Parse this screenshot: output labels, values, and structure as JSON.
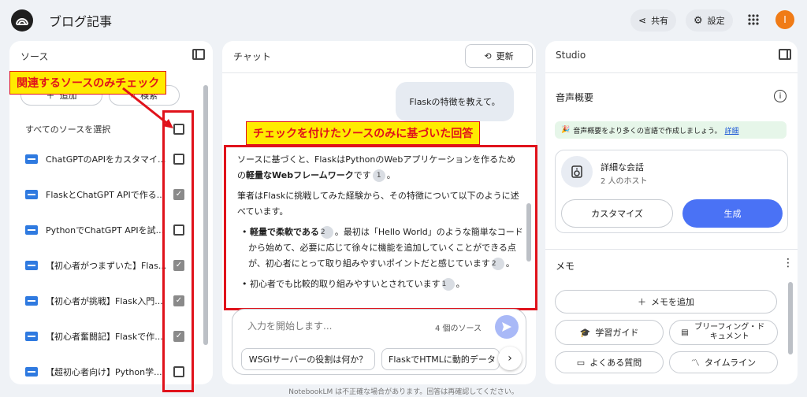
{
  "header": {
    "title": "ブログ記事",
    "share_label": "共有",
    "settings_label": "設定",
    "avatar_letter": "I"
  },
  "sources": {
    "title": "ソース",
    "add_label": "追加",
    "search_label": "検索",
    "select_all_label": "すべてのソースを選択",
    "items": [
      {
        "label": "ChatGPTのAPIをカスタマイ...",
        "checked": false
      },
      {
        "label": "FlaskとChatGPT APIで作る...",
        "checked": true
      },
      {
        "label": "PythonでChatGPT APIを試...",
        "checked": false
      },
      {
        "label": "【初心者がつまずいた】Flas...",
        "checked": true
      },
      {
        "label": "【初心者が挑戦】Flask入門...",
        "checked": true
      },
      {
        "label": "【初心者奮闘記】Flaskで作...",
        "checked": true
      },
      {
        "label": "【超初心者向け】Python学...",
        "checked": false
      }
    ]
  },
  "chat": {
    "title": "チャット",
    "refresh_label": "更新",
    "user_message": "Flaskの特徴を教えて。",
    "response": {
      "p1": "ソースに基づくと、FlaskはPythonのWebアプリケーションを作るための",
      "p1_bold": "軽量なWebフレームワーク",
      "p1_end": "です",
      "p1_cite": "1",
      "p2": "筆者はFlaskに挑戦してみた経験から、その特徴について以下のように述べています。",
      "b1_bold": "軽量で柔軟である",
      "b1_cite": "2",
      "b1_text": "。最初は「Hello World」のような簡単なコードから始めて、必要に応じて徐々に機能を追加していくことができる点が、初心者にとって取り組みやすいポイントだと感じています",
      "b1_cite2": "2",
      "b2_text": "初心者でも比較的取り組みやすいとされています",
      "b2_cite": "1"
    },
    "input_placeholder": "入力を開始します...",
    "source_count": "4 個のソース",
    "suggestions": [
      "WSGIサーバーの役割は何か？",
      "FlaskでHTMLに動的データ"
    ]
  },
  "studio": {
    "title": "Studio",
    "audio_title": "音声概要",
    "banner_text": "音声概要をより多くの言語で作成しましょう。",
    "banner_link": "詳細",
    "conv_title": "詳細な会話",
    "conv_sub": "2 人のホスト",
    "customize_label": "カスタマイズ",
    "generate_label": "生成",
    "memo_title": "メモ",
    "add_memo_label": "メモを追加",
    "buttons": [
      "学習ガイド",
      "ブリーフィング・ドキュメント",
      "よくある質問",
      "タイムライン"
    ]
  },
  "annotations": {
    "left_callout": "関連するソースのみチェック",
    "right_callout": "チェックを付けたソースのみに基づいた回答"
  },
  "footer": "NotebookLM は不正確な場合があります。回答は再確認してください。",
  "colors": {
    "accent": "#4a72f5",
    "annotation_red": "#e0121b",
    "annotation_yellow": "#ffeb00",
    "doc_icon": "#2f7ae0"
  }
}
